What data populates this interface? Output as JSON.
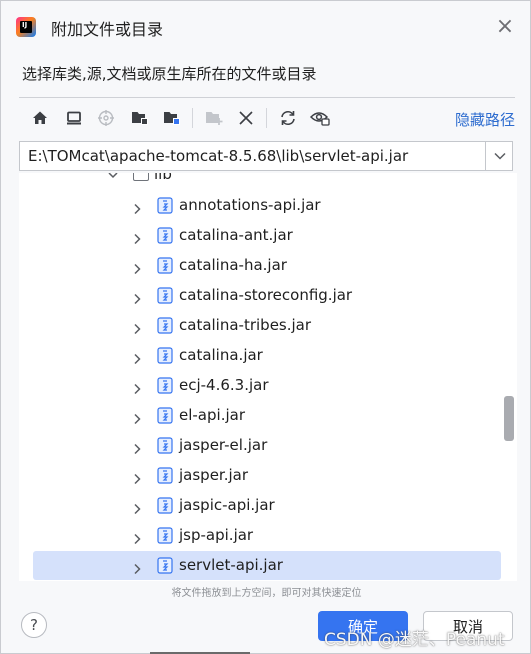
{
  "window": {
    "title": "附加文件或目录",
    "subtitle": "选择库类,源,文档或原生库所在的文件或目录"
  },
  "toolbar": {
    "hide_path_label": "隐藏路径",
    "buttons": [
      {
        "name": "home-icon"
      },
      {
        "name": "desktop-icon"
      },
      {
        "name": "locate-icon"
      },
      {
        "name": "project-folder-icon"
      },
      {
        "name": "module-folder-icon"
      },
      {
        "name": "new-folder-icon"
      },
      {
        "name": "delete-icon"
      },
      {
        "name": "refresh-icon"
      },
      {
        "name": "show-hidden-icon"
      }
    ]
  },
  "path_field": {
    "value": "E:\\TOMcat\\apache-tomcat-8.5.68\\lib\\servlet-api.jar"
  },
  "tree": {
    "parent_label": "lib",
    "items": [
      {
        "label": "annotations-api.jar",
        "selected": false
      },
      {
        "label": "catalina-ant.jar",
        "selected": false
      },
      {
        "label": "catalina-ha.jar",
        "selected": false
      },
      {
        "label": "catalina-storeconfig.jar",
        "selected": false
      },
      {
        "label": "catalina-tribes.jar",
        "selected": false
      },
      {
        "label": "catalina.jar",
        "selected": false
      },
      {
        "label": "ecj-4.6.3.jar",
        "selected": false
      },
      {
        "label": "el-api.jar",
        "selected": false
      },
      {
        "label": "jasper-el.jar",
        "selected": false
      },
      {
        "label": "jasper.jar",
        "selected": false
      },
      {
        "label": "jaspic-api.jar",
        "selected": false
      },
      {
        "label": "jsp-api.jar",
        "selected": false
      },
      {
        "label": "servlet-api.jar",
        "selected": true
      }
    ],
    "hint": "将文件拖放到上方空间，即可对其快速定位"
  },
  "footer": {
    "help_label": "?",
    "ok_label": "确定",
    "cancel_label": "取消"
  },
  "watermark": "CSDN @迷茫、Peanut",
  "colors": {
    "accent": "#3574f0",
    "link": "#2d6ccf",
    "selection": "#d5e1fb"
  }
}
